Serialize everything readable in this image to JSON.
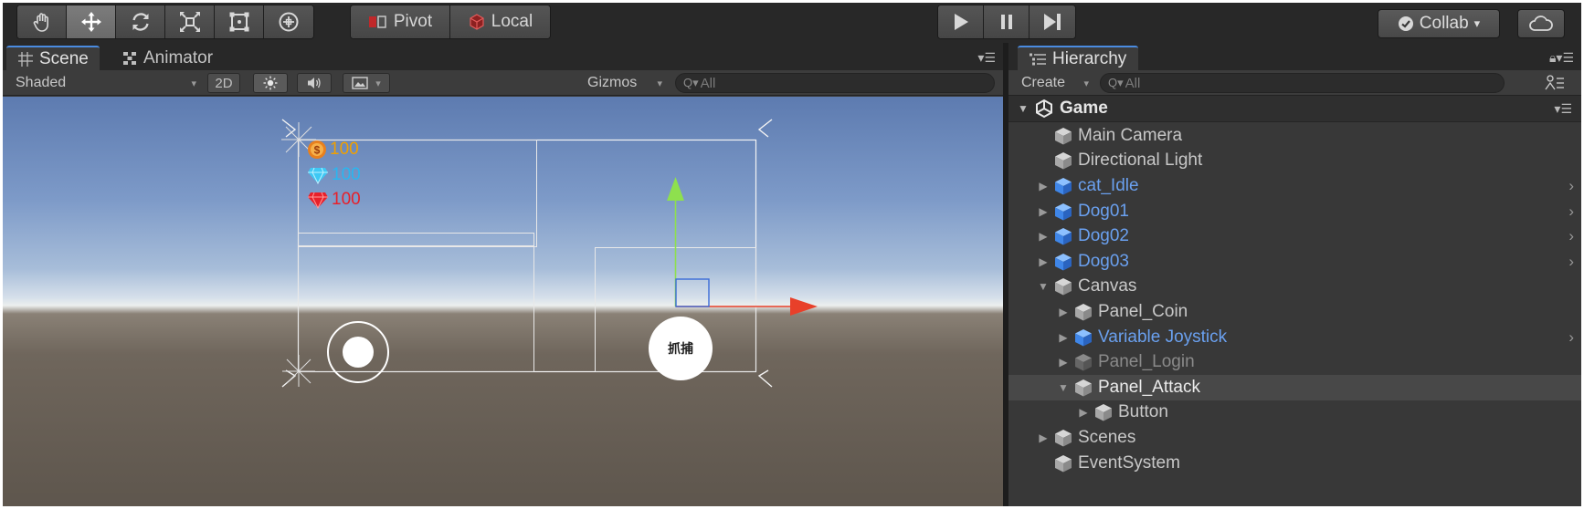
{
  "toolbar": {
    "tools": [
      "hand-icon",
      "move-icon",
      "rotate-icon",
      "scale-icon",
      "rect-icon",
      "transform-icon"
    ],
    "active_tool_index": 1,
    "pivot_label": "Pivot",
    "local_label": "Local",
    "collab_label": "Collab",
    "collab_arrow": "▾",
    "play_icon": "play-icon",
    "pause_icon": "pause-icon",
    "step_icon": "step-icon",
    "cloud_icon": "cloud-icon"
  },
  "scene": {
    "tabs": [
      {
        "label": "Scene",
        "icon": "grid-icon",
        "active": true
      },
      {
        "label": "Animator",
        "icon": "animator-icon",
        "active": false
      }
    ],
    "shading_mode": "Shaded",
    "mode_2d_label": "2D",
    "gizmos_label": "Gizmos",
    "search_placeholder": "All",
    "search_prefix": "Q▾",
    "stats": [
      {
        "icon": "coin-icon",
        "value": "100",
        "color": "#f0a000"
      },
      {
        "icon": "diamond-icon",
        "value": "100",
        "color": "#2ab6f0"
      },
      {
        "icon": "ruby-icon",
        "value": "100",
        "color": "#e8202a"
      }
    ],
    "attack_label": "抓捕"
  },
  "hierarchy": {
    "tab_label": "Hierarchy",
    "create_label": "Create",
    "search_placeholder": "All",
    "search_prefix": "Q▾",
    "scene_name": "Game",
    "items": [
      {
        "name": "Main Camera",
        "depth": 1,
        "expand": "",
        "type": "normal",
        "chevron": ""
      },
      {
        "name": "Directional Light",
        "depth": 1,
        "expand": "",
        "type": "normal",
        "chevron": ""
      },
      {
        "name": "cat_Idle",
        "depth": 1,
        "expand": "▶",
        "type": "prefab",
        "chevron": "›"
      },
      {
        "name": "Dog01",
        "depth": 1,
        "expand": "▶",
        "type": "prefab",
        "chevron": "›"
      },
      {
        "name": "Dog02",
        "depth": 1,
        "expand": "▶",
        "type": "prefab",
        "chevron": "›"
      },
      {
        "name": "Dog03",
        "depth": 1,
        "expand": "▶",
        "type": "prefab",
        "chevron": "›"
      },
      {
        "name": "Canvas",
        "depth": 1,
        "expand": "▼",
        "type": "normal",
        "chevron": ""
      },
      {
        "name": "Panel_Coin",
        "depth": 2,
        "expand": "▶",
        "type": "normal",
        "chevron": ""
      },
      {
        "name": "Variable Joystick",
        "depth": 2,
        "expand": "▶",
        "type": "prefab",
        "chevron": "›"
      },
      {
        "name": "Panel_Login",
        "depth": 2,
        "expand": "▶",
        "type": "dim",
        "chevron": ""
      },
      {
        "name": "Panel_Attack",
        "depth": 2,
        "expand": "▼",
        "type": "normal",
        "chevron": "",
        "selected": true
      },
      {
        "name": "Button",
        "depth": 3,
        "expand": "▶",
        "type": "normal",
        "chevron": ""
      },
      {
        "name": "Scenes",
        "depth": 1,
        "expand": "▶",
        "type": "normal",
        "chevron": ""
      },
      {
        "name": "EventSystem",
        "depth": 1,
        "expand": "",
        "type": "normal",
        "chevron": ""
      }
    ]
  }
}
